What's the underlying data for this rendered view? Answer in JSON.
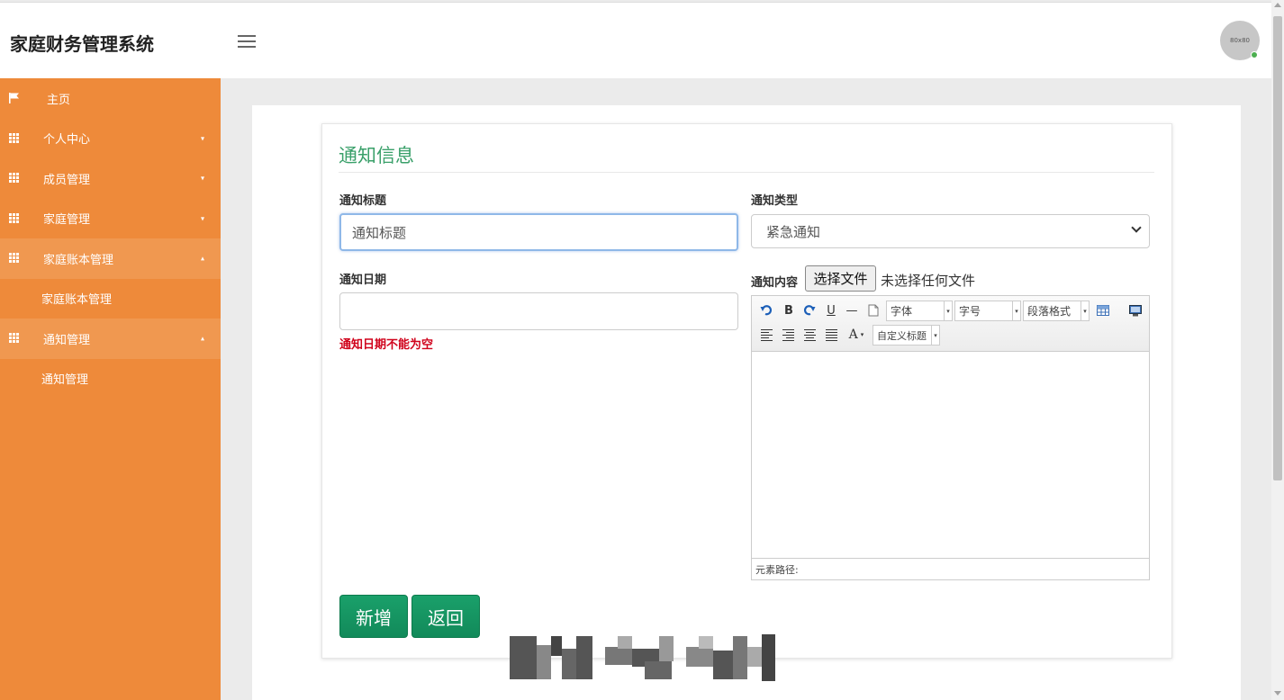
{
  "app": {
    "title": "家庭财务管理系统",
    "avatar_text": "80x80"
  },
  "sidebar": {
    "items": [
      {
        "label": "主页",
        "icon": "flag-icon"
      },
      {
        "label": "个人中心",
        "icon": "grid-icon",
        "caret": "▾"
      },
      {
        "label": "成员管理",
        "icon": "grid-icon",
        "caret": "▾"
      },
      {
        "label": "家庭管理",
        "icon": "grid-icon",
        "caret": "▾"
      },
      {
        "label": "家庭账本管理",
        "icon": "grid-icon",
        "caret": "▴",
        "open": true,
        "sub": "家庭账本管理"
      },
      {
        "label": "通知管理",
        "icon": "grid-icon",
        "caret": "▴",
        "open": true,
        "sub": "通知管理"
      }
    ]
  },
  "form": {
    "title": "通知信息",
    "notice_title": {
      "label": "通知标题",
      "value": "通知标题"
    },
    "notice_type": {
      "label": "通知类型",
      "selected": "紧急通知"
    },
    "notice_date": {
      "label": "通知日期",
      "value": "",
      "error": "通知日期不能为空"
    },
    "notice_content": {
      "label": "通知内容",
      "file_button": "选择文件",
      "file_status": "未选择任何文件"
    },
    "editor": {
      "font": "字体",
      "size": "字号",
      "paragraph": "段落格式",
      "custom_title": "自定义标题",
      "bold": "B",
      "underline": "U",
      "hr": "—",
      "color": "A",
      "path_label": "元素路径:"
    },
    "buttons": {
      "add": "新增",
      "back": "返回"
    }
  },
  "colors": {
    "sidebar": "#ee8a3a",
    "accent": "#3aa06a",
    "button": "#1aa06a",
    "error": "#d0021b"
  }
}
